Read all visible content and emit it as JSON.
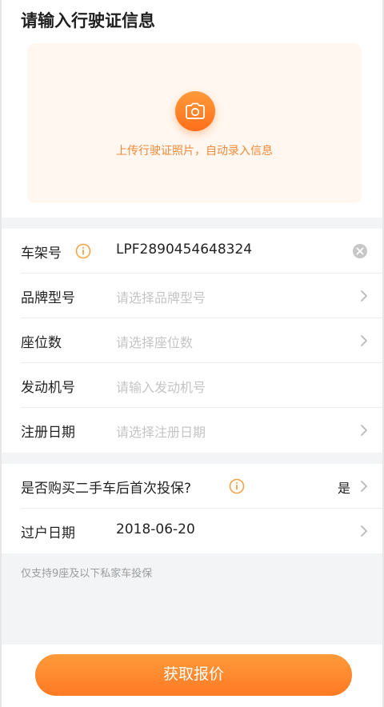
{
  "page": {
    "title": "请输入行驶证信息"
  },
  "upload": {
    "hint": "上传行驶证照片，自动录入信息",
    "icon": "camera-icon"
  },
  "form": {
    "vin": {
      "label": "车架号",
      "value": "LPF2890454648324"
    },
    "brand_model": {
      "label": "品牌型号",
      "placeholder": "请选择品牌型号"
    },
    "seats": {
      "label": "座位数",
      "placeholder": "请选择座位数"
    },
    "engine_no": {
      "label": "发动机号",
      "placeholder": "请输入发动机号"
    },
    "reg_date": {
      "label": "注册日期",
      "placeholder": "请选择注册日期"
    },
    "first_insure": {
      "label": "是否购买二手车后首次投保?",
      "value": "是"
    },
    "transfer_date": {
      "label": "过户日期",
      "value": "2018-06-20"
    }
  },
  "note": "仅支持9座及以下私家车投保",
  "submit_label": "获取报价",
  "colors": {
    "accent": "#ff7a24",
    "accent_light": "#ff9a3a",
    "card_bg": "#fff7f0",
    "hint": "#f08a3a",
    "placeholder": "#c4c4c4",
    "section_bg": "#f3f4f6"
  }
}
